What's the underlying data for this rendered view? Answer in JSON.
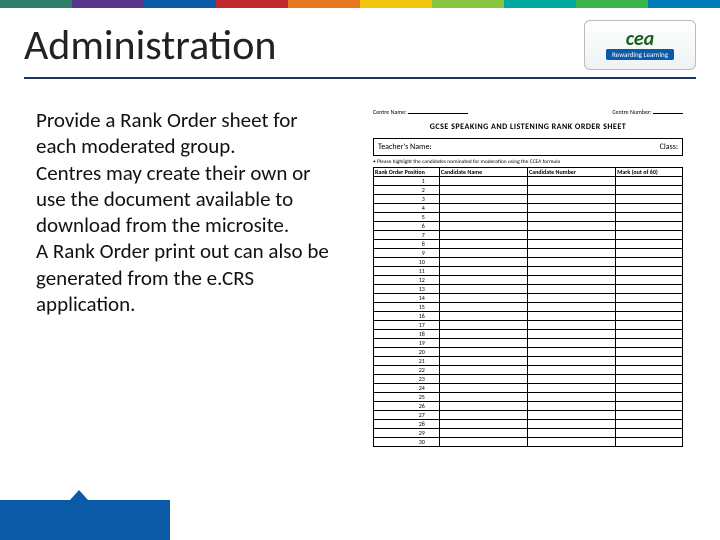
{
  "slide": {
    "title": "Administration",
    "body": "Provide a Rank Order sheet for each moderated group.\nCentres may create their own or use the document available to download from the microsite.\nA Rank Order print out can also be generated from the e.CRS application."
  },
  "brand": {
    "name": "cea",
    "tagline": "Rewarding Learning"
  },
  "sheet": {
    "centre_name_label": "Centre Name:",
    "centre_number_label": "Centre Number:",
    "title": "GCSE SPEAKING AND LISTENING RANK ORDER SHEET",
    "teacher_label": "Teacher's Name:",
    "class_label": "Class:",
    "note": "• Please highlight the candidates nominated for moderation using the CCEA formula",
    "columns": {
      "rank": "Rank Order Position",
      "candidate_name": "Candidate Name",
      "candidate_number": "Candidate Number",
      "mark": "Mark (out of 60)"
    },
    "rows": [
      1,
      2,
      3,
      4,
      5,
      6,
      7,
      8,
      9,
      10,
      11,
      12,
      13,
      14,
      15,
      16,
      17,
      18,
      19,
      20,
      21,
      22,
      23,
      24,
      25,
      26,
      27,
      28,
      29,
      30
    ]
  }
}
